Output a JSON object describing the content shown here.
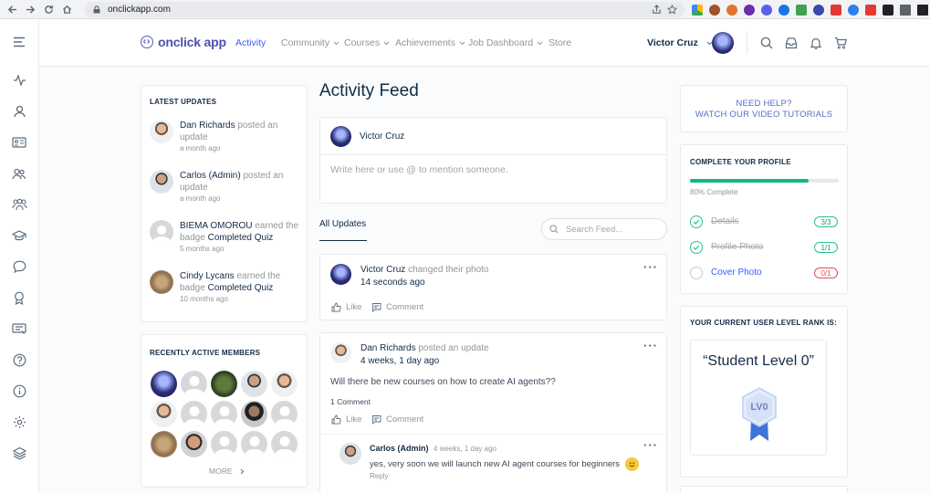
{
  "browser": {
    "url": "onclickapp.com"
  },
  "header": {
    "logo_text": "onclick app",
    "nav": [
      {
        "label": "Activity",
        "dropdown": false,
        "active": true
      },
      {
        "label": "Community",
        "dropdown": true
      },
      {
        "label": "Courses",
        "dropdown": true
      },
      {
        "label": "Achievements",
        "dropdown": true
      },
      {
        "label": "Job Dashboard",
        "dropdown": true
      },
      {
        "label": "Store",
        "dropdown": false
      }
    ],
    "user_name": "Victor Cruz"
  },
  "latest_updates": {
    "title": "LATEST UPDATES",
    "items": [
      {
        "name": "Dan Richards",
        "action": "posted an update",
        "badge": "",
        "time": "a month ago"
      },
      {
        "name": "Carlos (Admin)",
        "action": "posted an update",
        "badge": "",
        "time": "a month ago"
      },
      {
        "name": "BIEMA OMOROU",
        "action": "earned the badge",
        "badge": "Completed Quiz",
        "time": "5 months ago"
      },
      {
        "name": "Cindy Lycans",
        "action": "earned the badge",
        "badge": "Completed Quiz",
        "time": "10 months ago"
      }
    ]
  },
  "recent_members": {
    "title": "RECENTLY ACTIVE MEMBERS",
    "more_label": "MORE"
  },
  "feed": {
    "title": "Activity Feed",
    "composer_user": "Victor Cruz",
    "composer_placeholder": "Write here or use @ to mention someone.",
    "tab_all": "All Updates",
    "search_placeholder": "Search Feed...",
    "posts": [
      {
        "author": "Victor Cruz",
        "action": "changed their photo",
        "time": "14 seconds ago",
        "like": "Like",
        "comment": "Comment"
      },
      {
        "author": "Dan Richards",
        "action": "posted an update",
        "time": "4 weeks, 1 day ago",
        "body": "Will there be new courses on how to create AI agents??",
        "comment_count": "1 Comment",
        "like": "Like",
        "comment": "Comment",
        "reply": {
          "author": "Carlos (Admin)",
          "time": "4 weeks, 1 day ago",
          "text": "yes, very soon we will launch new AI agent courses for beginners",
          "reply_label": "Reply"
        }
      }
    ]
  },
  "help": {
    "line1": "NEED HELP?",
    "line2": "WATCH OUR VIDEO TUTORIALS"
  },
  "profile": {
    "title": "COMPLETE YOUR PROFILE",
    "progress_percent": 80,
    "progress_label": "80% Complete",
    "steps": [
      {
        "label": "Details",
        "count": "3/3",
        "done": true
      },
      {
        "label": "Profile Photo",
        "count": "1/1",
        "done": true
      },
      {
        "label": "Cover Photo",
        "count": "0/1",
        "done": false
      }
    ]
  },
  "rank": {
    "title": "YOUR CURRENT USER LEVEL RANK IS:",
    "level_name": "“Student Level 0”",
    "badge_text": "LV0"
  },
  "colors": {
    "brand": "#4f4fb0",
    "link": "#385dff",
    "success": "#10b981",
    "danger": "#e84d4d"
  }
}
